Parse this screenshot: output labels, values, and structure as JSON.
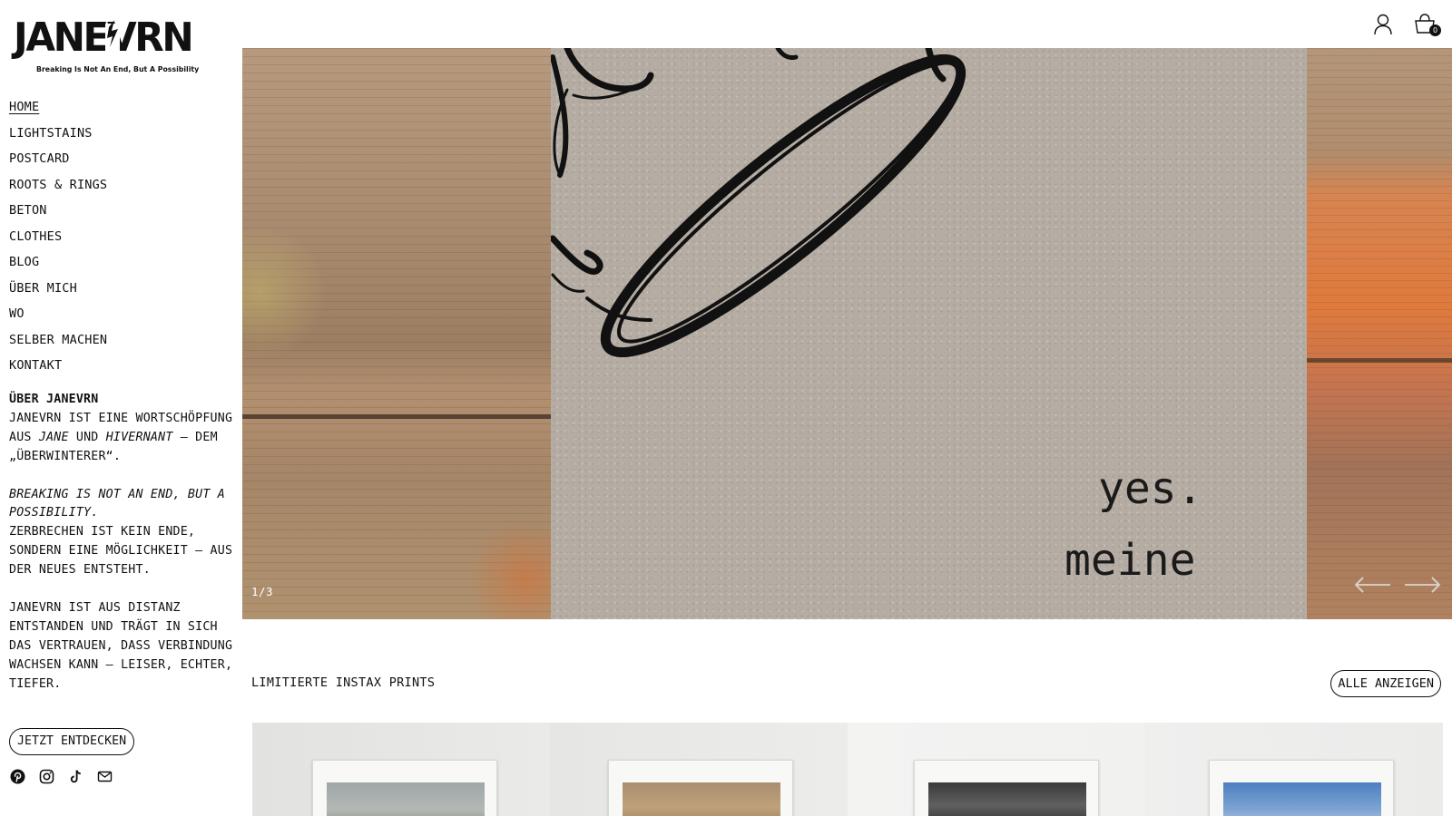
{
  "brand": {
    "name": "JANEVRN",
    "tagline": "Breaking Is Not An End, But A Possibility"
  },
  "nav": [
    {
      "label": "HOME",
      "active": true
    },
    {
      "label": "LIGHTSTAINS"
    },
    {
      "label": "POSTCARD"
    },
    {
      "label": "ROOTS & RINGS"
    },
    {
      "label": "BETON"
    },
    {
      "label": "CLOTHES"
    },
    {
      "label": "BLOG"
    },
    {
      "label": "ÜBER MICH"
    },
    {
      "label": "WO"
    },
    {
      "label": "SELBER MACHEN"
    },
    {
      "label": "KONTAKT"
    }
  ],
  "about": {
    "heading": "ÜBER JANEVRN",
    "p1_a": "JANEVRN IST EINE WORTSCHÖPFUNG AUS ",
    "p1_jane": "JANE",
    "p1_und": " UND ",
    "p1_hivernant": "HIVERNANT",
    "p1_b": " – DEM „ÜBERWINTERER“.",
    "motto": "BREAKING IS NOT AN END, BUT A POSSIBILITY.",
    "p2": "ZERBRECHEN IST KEIN ENDE, SONDERN EINE MÖGLICHKEIT – AUS DER NEUES ENTSTEHT.",
    "p3": "JANEVRN IST AUS DISTANZ ENTSTANDEN UND TRÄGT IN SICH DAS VERTRAUEN, DASS VERBINDUNG WACHSEN KANN – LEISER, ECHTER, TIEFER."
  },
  "cta_label": "JETZT ENTDECKEN",
  "socials": [
    "pinterest-icon",
    "instagram-icon",
    "tiktok-icon",
    "mail-icon"
  ],
  "header": {
    "cart_count": "0"
  },
  "hero": {
    "line1": "yes.",
    "line2": "meine",
    "counter": "1/3"
  },
  "section": {
    "title": "LIMITIERTE INSTAX PRINTS",
    "view_all": "ALLE ANZEIGEN"
  },
  "colors": {
    "text": "#111111",
    "background": "#ffffff",
    "card": "#b5ada3",
    "wood_orange": "#e07a3c"
  }
}
